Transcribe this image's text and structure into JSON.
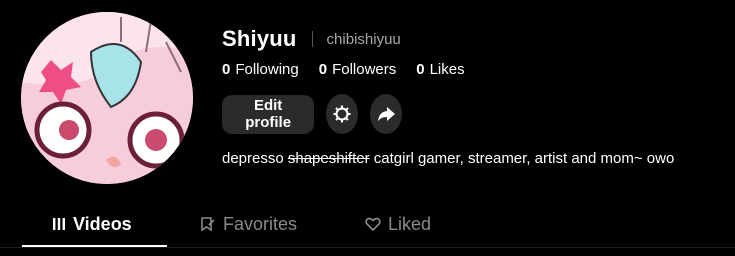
{
  "profile": {
    "display_name": "Shiyuu",
    "username": "chibishiyuu",
    "stats": [
      {
        "value": "0",
        "label": "Following"
      },
      {
        "value": "0",
        "label": "Followers"
      },
      {
        "value": "0",
        "label": "Likes"
      }
    ],
    "bio_before": "depresso ",
    "bio_strike": "shapeshifter",
    "bio_after": " catgirl gamer, streamer, artist and mom~ owo"
  },
  "actions": {
    "edit_label": "Edit profile",
    "settings_icon": "gear-icon",
    "share_icon": "share-arrow-icon"
  },
  "tabs": [
    {
      "label": "Videos",
      "icon": "grid-icon",
      "active": true
    },
    {
      "label": "Favorites",
      "icon": "bookmark-icon",
      "active": false
    },
    {
      "label": "Liked",
      "icon": "heart-icon",
      "active": false
    }
  ],
  "colors": {
    "background": "#000000",
    "button_bg": "#2b2b2b",
    "muted_text": "#a8a8a8",
    "inactive_tab": "#8a8a8a"
  }
}
